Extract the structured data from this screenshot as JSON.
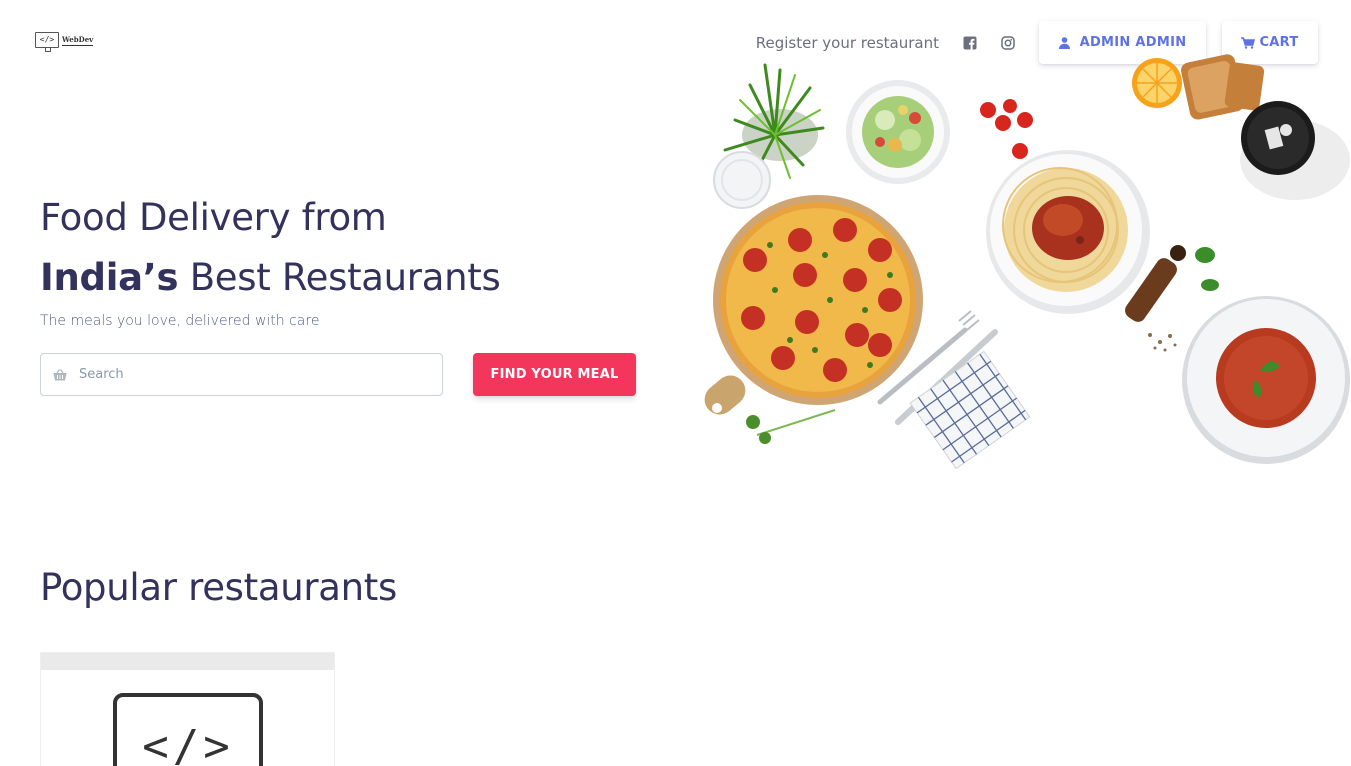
{
  "logo": {
    "code": "</>",
    "text": "WebDev"
  },
  "nav": {
    "register_label": "Register your restaurant",
    "facebook_icon": "facebook-square-icon",
    "instagram_icon": "instagram-icon",
    "admin_label": "ADMIN ADMIN",
    "cart_label": "CART"
  },
  "hero": {
    "title_line1": "Food Delivery from",
    "title_bold": "India’s",
    "title_line2_rest": " Best Restaurants",
    "subtitle": "The meals you love, delivered with care",
    "search_placeholder": "Search",
    "find_button": "FIND YOUR MEAL"
  },
  "section": {
    "title": "Popular restaurants"
  },
  "card": {
    "image_text": "</>"
  },
  "colors": {
    "primary": "#5e72e4",
    "danger": "#f5365c",
    "heading": "#32325d"
  }
}
